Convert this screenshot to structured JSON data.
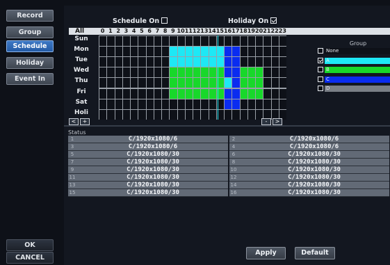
{
  "menu": {
    "items": [
      {
        "label": "Record",
        "active": false
      },
      {
        "label": "Group",
        "active": false
      },
      {
        "label": "Schedule",
        "active": true
      },
      {
        "label": "Holiday",
        "active": false
      },
      {
        "label": "Event In",
        "active": false
      }
    ],
    "ok_label": "OK",
    "cancel_label": "CANCEL"
  },
  "schedule": {
    "schedule_on_label": "Schedule On",
    "schedule_on_checked": false,
    "holiday_on_label": "Holiday On",
    "holiday_on_checked": true,
    "all_label": "All",
    "hours": [
      "0",
      "1",
      "2",
      "3",
      "4",
      "5",
      "6",
      "7",
      "8",
      "9",
      "10",
      "11",
      "12",
      "13",
      "14",
      "15",
      "16",
      "17",
      "18",
      "19",
      "20",
      "21",
      "22",
      "23"
    ],
    "days": [
      "Sun",
      "Mon",
      "Tue",
      "Wed",
      "Thu",
      "Fri",
      "Sat",
      "Holi"
    ],
    "grid": [
      "NNNNNNNNNNNNNNNNNNNNNNNN",
      "NNNNNNNNNAAAAAAACCNNNNNN",
      "NNNNNNNNNAAAAAAACCNNNNNN",
      "NNNNNNNNNBBBBBBBCCBBBNNN",
      "NNNNNNNNNBBBBBBBACBBBNNN",
      "NNNNNNNNNBBBBBBBCCBBBNNN",
      "NNNNNNNNNNNNNNNNCCNNNNNN",
      "NNNNNNNNNNNNNNNNNNNNNNNN"
    ],
    "nav": {
      "prev": "<",
      "plus": "+",
      "minus": "-",
      "next": ">"
    }
  },
  "group_legend": {
    "title": "Group",
    "items": [
      {
        "key": "N",
        "label": "None",
        "checked": false,
        "color": "#0e1118"
      },
      {
        "key": "A",
        "label": "A",
        "checked": true,
        "color": "#1ee8f5"
      },
      {
        "key": "B",
        "label": "B",
        "checked": false,
        "color": "#18d82a"
      },
      {
        "key": "C",
        "label": "C",
        "checked": false,
        "color": "#0a2cf0"
      },
      {
        "key": "D",
        "label": "D",
        "checked": false,
        "color": "#7a7f86"
      }
    ]
  },
  "status": {
    "title": "Status",
    "left": [
      {
        "ch": "1",
        "value": "C/1920x1080/6"
      },
      {
        "ch": "3",
        "value": "C/1920x1080/6"
      },
      {
        "ch": "5",
        "value": "C/1920x1080/30"
      },
      {
        "ch": "7",
        "value": "C/1920x1080/30"
      },
      {
        "ch": "9",
        "value": "C/1920x1080/30"
      },
      {
        "ch": "11",
        "value": "C/1920x1080/30"
      },
      {
        "ch": "13",
        "value": "C/1920x1080/30"
      },
      {
        "ch": "15",
        "value": "C/1920x1080/30"
      }
    ],
    "right": [
      {
        "ch": "2",
        "value": "C/1920x1080/6"
      },
      {
        "ch": "4",
        "value": "C/1920x1080/6"
      },
      {
        "ch": "6",
        "value": "C/1920x1080/30"
      },
      {
        "ch": "8",
        "value": "C/1920x1080/30"
      },
      {
        "ch": "10",
        "value": "C/1920x1080/30"
      },
      {
        "ch": "12",
        "value": "C/1920x1080/30"
      },
      {
        "ch": "14",
        "value": "C/1920x1080/30"
      },
      {
        "ch": "16",
        "value": "C/1920x1080/30"
      }
    ]
  },
  "actions": {
    "apply_label": "Apply",
    "default_label": "Default"
  },
  "colors": {
    "grid_bg": "#0e1118",
    "grid_line": "#9aa0a8",
    "marker": "#1ee8f5"
  }
}
